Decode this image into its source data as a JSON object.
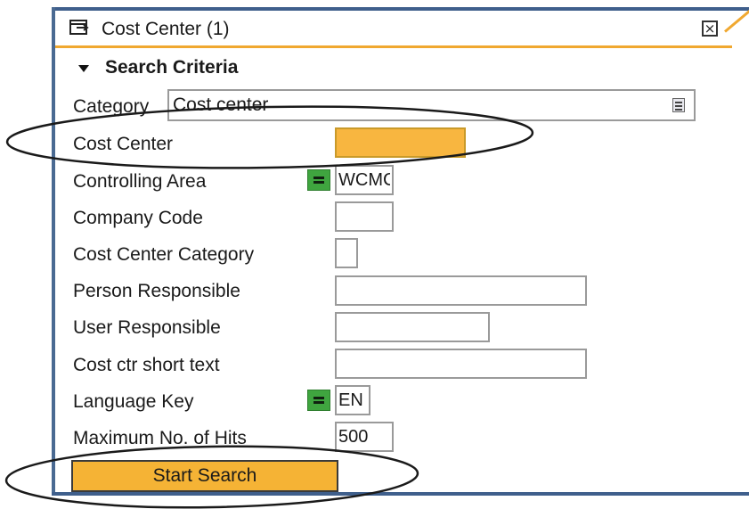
{
  "dialog": {
    "title": "Cost Center (1)",
    "close_symbol": "×",
    "title_icon": "dialog-window-icon"
  },
  "search_criteria": {
    "section_title": "Search Criteria",
    "collapse_icon": "triangle-down-icon",
    "category": {
      "label": "Category",
      "value": "Cost center",
      "icon": "dropdown-list-icon"
    },
    "fields": [
      {
        "label": "Cost Center",
        "value": "",
        "required": true
      },
      {
        "label": "Controlling Area",
        "value": "WCMC",
        "operator": "equals"
      },
      {
        "label": "Company Code",
        "value": ""
      },
      {
        "label": "Cost Center Category",
        "value": ""
      },
      {
        "label": "Person Responsible",
        "value": ""
      },
      {
        "label": "User Responsible",
        "value": ""
      },
      {
        "label": "Cost ctr short text",
        "value": ""
      },
      {
        "label": "Language Key",
        "value": "EN",
        "operator": "equals"
      },
      {
        "label": "Maximum No. of Hits",
        "value": "500"
      }
    ],
    "start_button": "Start Search"
  },
  "colors": {
    "accent_orange": "#f5b335",
    "frame_blue": "#3f5f8c",
    "operator_green": "#3fa53f"
  }
}
